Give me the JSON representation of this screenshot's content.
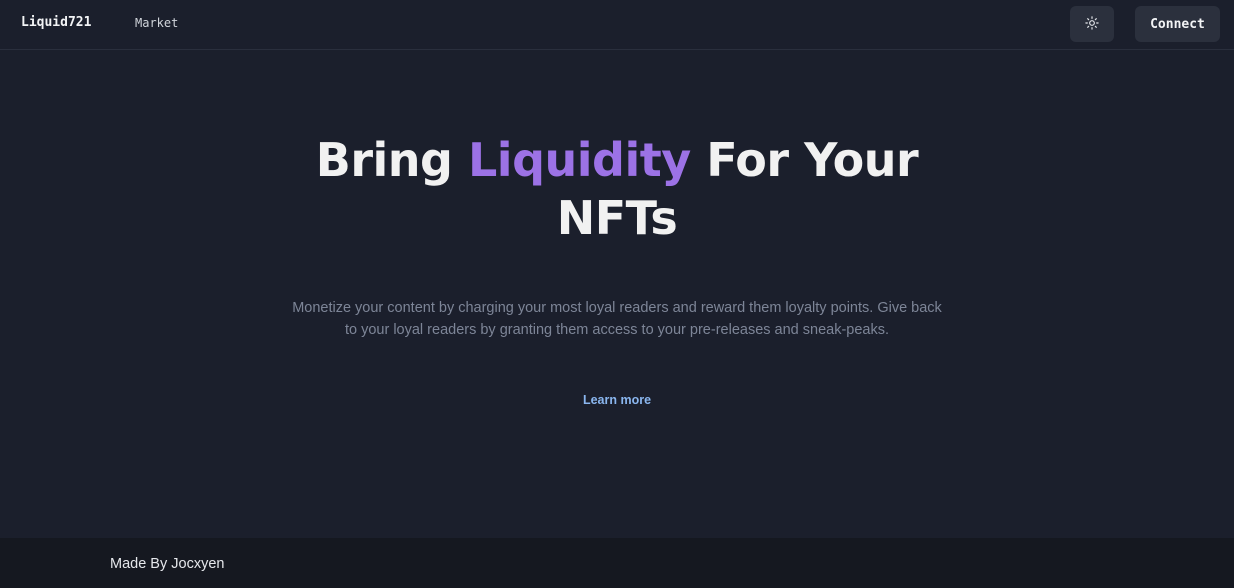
{
  "navbar": {
    "brand": "Liquid721",
    "links": [
      {
        "label": "Market"
      }
    ],
    "theme_toggle_icon": "sun-icon",
    "connect_label": "Connect"
  },
  "hero": {
    "title_prefix": "Bring ",
    "title_accent": "Liquidity",
    "title_suffix": " For Your NFTs",
    "description": "Monetize your content by charging your most loyal readers and reward them loyalty points. Give back to your loyal readers by granting them access to your pre-releases and sneak-peaks.",
    "cta_label": "Learn more"
  },
  "footer": {
    "text": "Made By Jocxyen"
  },
  "colors": {
    "background": "#1b1f2c",
    "accent": "#9c72e6",
    "link": "#8ab6ef",
    "footer_bg": "#151820"
  }
}
